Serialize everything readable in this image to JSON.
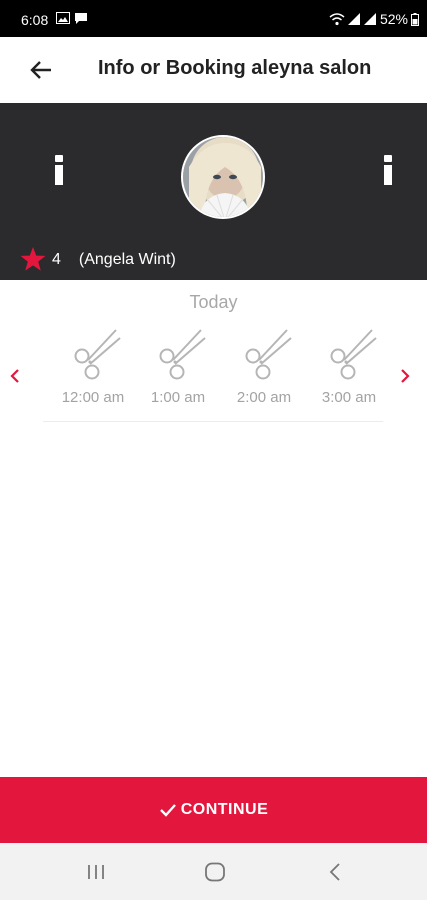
{
  "status_bar": {
    "time": "6:08",
    "battery_percent": "52%"
  },
  "app_bar": {
    "title": "Info or Booking aleyna salon"
  },
  "header": {
    "rating_value": "4",
    "stylist_name": "(Angela Wint)"
  },
  "booking": {
    "day_label": "Today",
    "slots": [
      {
        "time": "12:00 am"
      },
      {
        "time": "1:00 am"
      },
      {
        "time": "2:00 am"
      },
      {
        "time": "3:00 am"
      }
    ]
  },
  "footer": {
    "continue_label": "CONTINUE"
  },
  "colors": {
    "accent": "#e3173e",
    "header_bg": "#2b2b2d",
    "muted_text": "#a3a3a3"
  },
  "icons": {
    "back": "arrow-left-icon",
    "info": "info-icon",
    "star": "star-icon",
    "slot": "scissors-icon",
    "prev": "chevron-left-icon",
    "next": "chevron-right-icon",
    "check": "check-icon"
  }
}
